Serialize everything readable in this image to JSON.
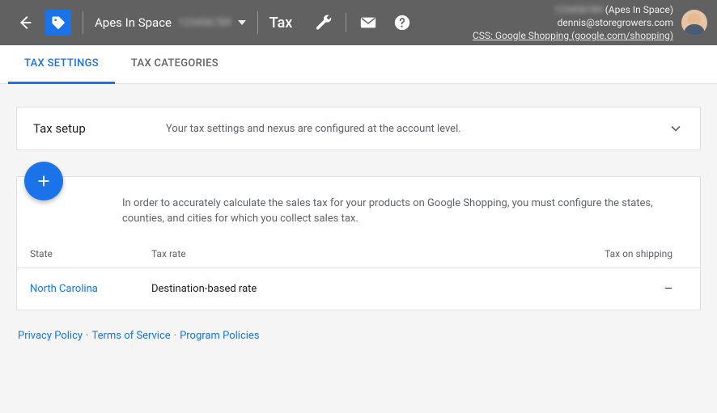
{
  "header": {
    "account_name": "Apes In Space",
    "account_id": "123456789",
    "section_title": "Tax",
    "info": {
      "line1_prefix": "123456789",
      "line1_name": "(Apes In Space)",
      "email": "dennis@storegrowers.com",
      "css": "CSS: Google Shopping (google.com/shopping)"
    }
  },
  "tabs": [
    "TAX SETTINGS",
    "TAX CATEGORIES"
  ],
  "panel": {
    "title": "Tax setup",
    "desc": "Your tax settings and nexus are configured at the account level."
  },
  "card": {
    "intro": "In order to accurately calculate the sales tax for your products on Google Shopping, you must configure the states, counties, and cities for which you collect sales tax.",
    "columns": [
      "State",
      "Tax rate",
      "Tax on shipping"
    ],
    "rows": [
      {
        "state": "North Carolina",
        "rate": "Destination-based rate",
        "shipping": "—"
      }
    ]
  },
  "footer": {
    "privacy": "Privacy Policy",
    "terms": "Terms of Service",
    "program": "Program Policies"
  }
}
